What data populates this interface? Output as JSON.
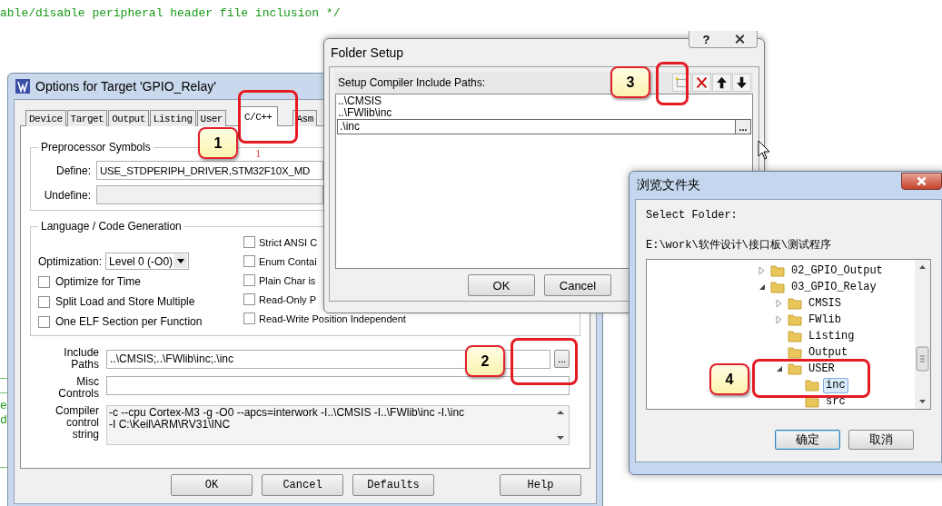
{
  "editor": {
    "code_line": "able/disable peripheral header file inclusion */",
    "edge_fragments": [
      "_",
      "_",
      "e",
      "d",
      "_"
    ]
  },
  "options_dialog": {
    "title": "Options for Target 'GPIO_Relay'",
    "tabs": [
      {
        "label": "Device",
        "selected": false
      },
      {
        "label": "Target",
        "selected": false
      },
      {
        "label": "Output",
        "selected": false
      },
      {
        "label": "Listing",
        "selected": false
      },
      {
        "label": "User",
        "selected": false
      },
      {
        "label": "C/C++",
        "selected": true
      },
      {
        "label": "Asm",
        "selected": false
      }
    ],
    "preprocessor": {
      "title": "Preprocessor Symbols",
      "define_label": "Define:",
      "define_value": "USE_STDPERIPH_DRIVER,STM32F10X_MD",
      "undefine_label": "Undefine:"
    },
    "language": {
      "title": "Language / Code Generation",
      "optimization_label": "Optimization:",
      "optimization_value": "Level 0 (-O0)",
      "left_options": [
        {
          "label": "Optimize for Time",
          "checked": false
        },
        {
          "label": "Split Load and Store Multiple",
          "checked": false
        },
        {
          "label": "One ELF Section per Function",
          "checked": false
        }
      ],
      "right_options": [
        {
          "label": "Strict ANSI C",
          "checked": false
        },
        {
          "label": "Enum Contai",
          "checked": false
        },
        {
          "label": "Plain Char is",
          "checked": false
        },
        {
          "label": "Read-Only P",
          "checked": false
        },
        {
          "label": "Read-Write Position Independent",
          "checked": false
        }
      ]
    },
    "include_paths": {
      "label": "Include Paths",
      "value": "..\\CMSIS;..\\FWlib\\inc;.\\inc",
      "browse": "..."
    },
    "misc_controls": {
      "label": "Misc Controls"
    },
    "compiler_string": {
      "label": "Compiler control string",
      "lines": [
        "-c --cpu Cortex-M3 -g -O0 --apcs=interwork -I..\\CMSIS -I..\\FWlib\\inc -I.\\inc",
        "-I C:\\Keil\\ARM\\RV31\\INC"
      ]
    },
    "buttons": [
      "OK",
      "Cancel",
      "Defaults",
      "Help"
    ]
  },
  "folder_setup": {
    "title": "Folder Setup",
    "help": "?",
    "header": "Setup Compiler Include Paths:",
    "paths": [
      {
        "text": "..\\CMSIS",
        "editing": false
      },
      {
        "text": "..\\FWlib\\inc",
        "editing": false
      },
      {
        "text": ".\\inc",
        "editing": true
      }
    ],
    "edit_browse": "...",
    "buttons": [
      "OK",
      "Cancel"
    ]
  },
  "browse_folder": {
    "title": "浏览文件夹",
    "prompt": "Select Folder:",
    "path": "E:\\work\\软件设计\\接口板\\测试程序",
    "tree": [
      {
        "label": "02_GPIO_Output",
        "expanded": false,
        "selected": false
      },
      {
        "label": "03_GPIO_Relay",
        "expanded": true,
        "selected": false,
        "children": [
          {
            "label": "CMSIS",
            "expanded": false,
            "selected": false
          },
          {
            "label": "FWlib",
            "expanded": false,
            "selected": false
          },
          {
            "label": "Listing",
            "selected": false
          },
          {
            "label": "Output",
            "selected": false
          },
          {
            "label": "USER",
            "expanded": true,
            "selected": false,
            "children": [
              {
                "label": "inc",
                "selected": true
              },
              {
                "label": "src",
                "selected": false
              }
            ]
          }
        ]
      }
    ],
    "buttons": [
      {
        "label": "确定",
        "default": true
      },
      {
        "label": "取消",
        "default": false
      }
    ]
  },
  "callouts": [
    {
      "number": "1"
    },
    {
      "number": "2"
    },
    {
      "number": "3"
    },
    {
      "number": "4"
    }
  ],
  "red_mark": "1"
}
